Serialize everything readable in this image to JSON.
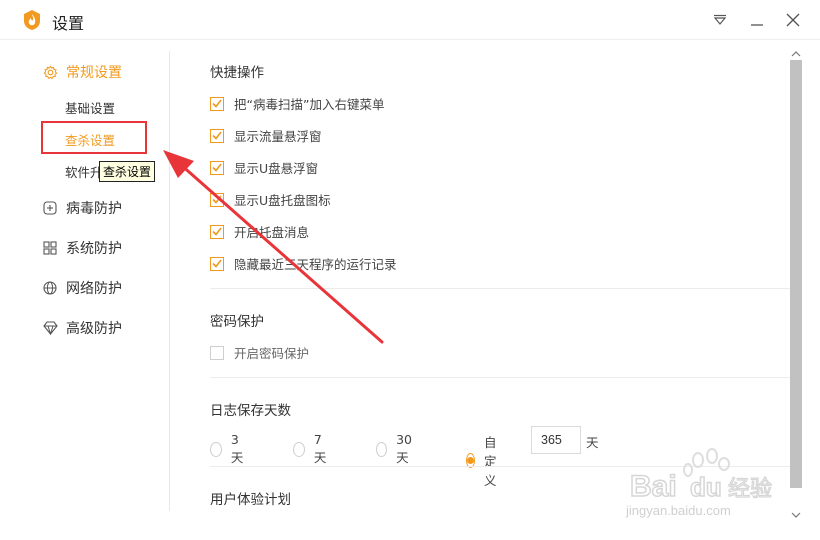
{
  "window": {
    "title": "设置",
    "icons": {
      "logo": "flame-shield-logo",
      "menu": "dropdown-menu-icon",
      "minimize": "minimize-icon",
      "close": "close-icon"
    }
  },
  "sidebar": {
    "groups": [
      {
        "label": "常规设置",
        "icon": "gear-icon",
        "active": true
      },
      {
        "label": "病毒防护",
        "icon": "plus-box-icon"
      },
      {
        "label": "系统防护",
        "icon": "grid-icon"
      },
      {
        "label": "网络防护",
        "icon": "globe-icon"
      },
      {
        "label": "高级防护",
        "icon": "diamond-icon"
      }
    ],
    "subitems": [
      {
        "label": "基础设置"
      },
      {
        "label": "查杀设置",
        "active": true
      },
      {
        "label": "软件升"
      }
    ],
    "tooltip": "查杀设置"
  },
  "content": {
    "quick_ops": {
      "title": "快捷操作",
      "options": [
        {
          "label": "把“病毒扫描”加入右键菜单",
          "checked": true
        },
        {
          "label": "显示流量悬浮窗",
          "checked": true
        },
        {
          "label": "显示U盘悬浮窗",
          "checked": true
        },
        {
          "label": "显示U盘托盘图标",
          "checked": true
        },
        {
          "label": "开启托盘消息",
          "checked": true
        },
        {
          "label": "隐藏最近三天程序的运行记录",
          "checked": true
        }
      ]
    },
    "password": {
      "title": "密码保护",
      "option": {
        "label": "开启密码保护",
        "checked": false
      }
    },
    "log_days": {
      "title": "日志保存天数",
      "options": [
        "3天",
        "7天",
        "30天",
        "自定义"
      ],
      "selected": "自定义",
      "custom_value": "365",
      "unit": "天"
    },
    "ux_plan": {
      "title": "用户体验计划"
    }
  },
  "colors": {
    "accent": "#f29a1f",
    "annotation_red": "#e8353a"
  },
  "watermark": {
    "logo_text": "Bai 经验",
    "url_text": "jingyan.baidu.com"
  }
}
